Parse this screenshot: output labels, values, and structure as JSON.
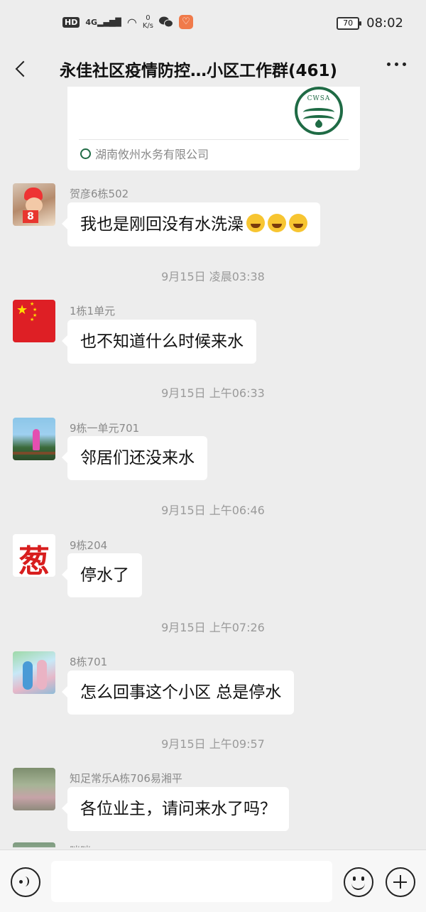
{
  "status_bar": {
    "hd": "HD",
    "network": "4G",
    "net_speed_value": "0",
    "net_speed_unit": "K/s",
    "battery": "70",
    "time": "08:02"
  },
  "header": {
    "title": "永佳社区疫情防控…小区工作群(461)"
  },
  "shared_card": {
    "logo_text": "CWSA",
    "source": "湖南攸州水务有限公司",
    "accent_color": "#1f6b45"
  },
  "messages": [
    {
      "sender": "贺彦6栋502",
      "text": "我也是刚回没有水洗澡",
      "emojis": 3,
      "avatar_badge": "8"
    },
    {
      "timestamp": "9月15日 凌晨03:38"
    },
    {
      "sender": "1栋1单元",
      "text": "也不知道什么时候来水"
    },
    {
      "timestamp": "9月15日 上午06:33"
    },
    {
      "sender": "9栋一单元701",
      "text": "邻居们还没来水"
    },
    {
      "timestamp": "9月15日 上午06:46"
    },
    {
      "sender": "9栋204",
      "text": "停水了",
      "avatar_char": "葱"
    },
    {
      "timestamp": "9月15日 上午07:26"
    },
    {
      "sender": "8栋701",
      "text": "怎么回事这个小区 总是停水"
    },
    {
      "timestamp": "9月15日 上午09:57"
    },
    {
      "sender": "知足常乐A栋706易湘平",
      "text": "各位业主，请问来水了吗？"
    },
    {
      "sender": "咪咪"
    }
  ],
  "input_bar": {
    "voice_icon": "voice-icon",
    "emoji_icon": "emoji-icon",
    "plus_icon": "plus-icon"
  }
}
